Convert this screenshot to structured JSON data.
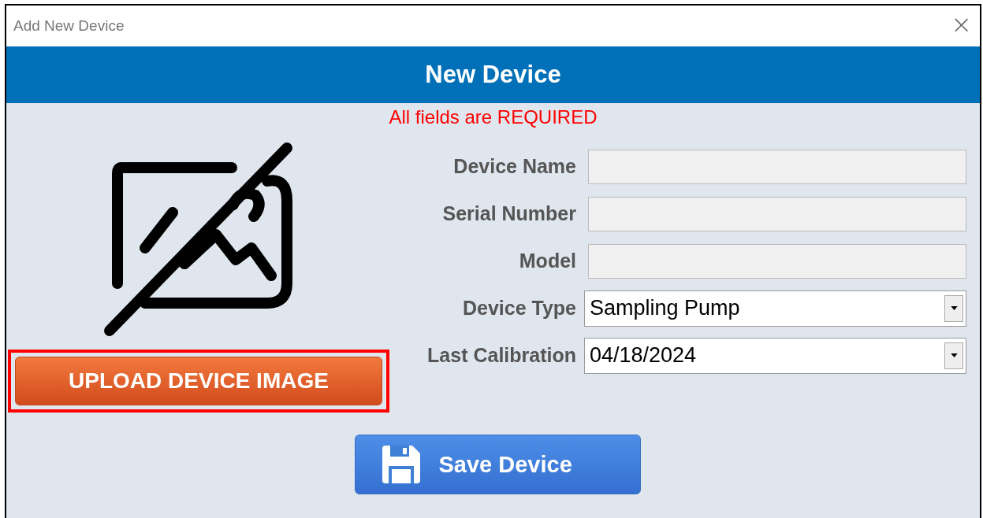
{
  "window": {
    "title": "Add New Device",
    "close": "×"
  },
  "header": {
    "title": "New Device"
  },
  "notice": "All fields are REQUIRED",
  "fields": [
    {
      "kind": "text",
      "label": "Device Name"
    },
    {
      "kind": "text",
      "label": "Serial Number"
    },
    {
      "kind": "text",
      "label": "Model"
    },
    {
      "kind": "dropdown",
      "label": "Device Type",
      "value": "Sampling Pump"
    },
    {
      "kind": "dropdown",
      "label": "Last Calibration",
      "value": "04/18/2024"
    }
  ],
  "upload_button": {
    "label": "UPLOAD DEVICE IMAGE",
    "highlighted": true
  },
  "save_button": {
    "label": "Save Device"
  }
}
